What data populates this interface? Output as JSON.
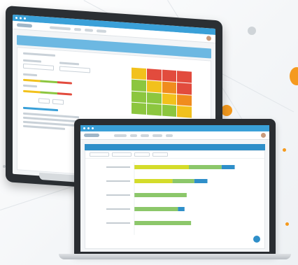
{
  "page": {
    "colors": {
      "accent_blue": "#3aa0d8",
      "bar_yellow": "#d4dc2a",
      "bar_green": "#8cc76a",
      "bar_blue": "#2f8fc9",
      "orange": "#f59a1e"
    }
  },
  "monitor": {
    "window_controls": [
      "dot",
      "dot",
      "dot"
    ],
    "risk_matrix": {
      "colors": [
        [
          "#f2c11c",
          "#e24b3d",
          "#e24b3d",
          "#e24b3d"
        ],
        [
          "#8cc63f",
          "#f2c11c",
          "#f08c1e",
          "#e24b3d"
        ],
        [
          "#8cc63f",
          "#8cc63f",
          "#f2c11c",
          "#f08c1e"
        ],
        [
          "#8cc63f",
          "#8cc63f",
          "#8cc63f",
          "#f2c11c"
        ]
      ]
    }
  },
  "laptop": {
    "window_controls": [
      "dot",
      "dot",
      "dot"
    ],
    "chart_data": {
      "type": "bar",
      "orientation": "horizontal-stacked",
      "categories": [
        "row-1",
        "row-2",
        "row-3",
        "row-4",
        "row-5"
      ],
      "series": [
        {
          "color": "#d4dc2a",
          "values": [
            5,
            3.5,
            0,
            0,
            0
          ]
        },
        {
          "color": "#8cc76a",
          "values": [
            3,
            2,
            4.8,
            4,
            5.2
          ]
        },
        {
          "color": "#2f8fc9",
          "values": [
            1.2,
            1.2,
            0,
            0.6,
            0
          ]
        }
      ],
      "xlim": [
        0,
        10
      ],
      "grid": false,
      "legend": "none"
    }
  }
}
